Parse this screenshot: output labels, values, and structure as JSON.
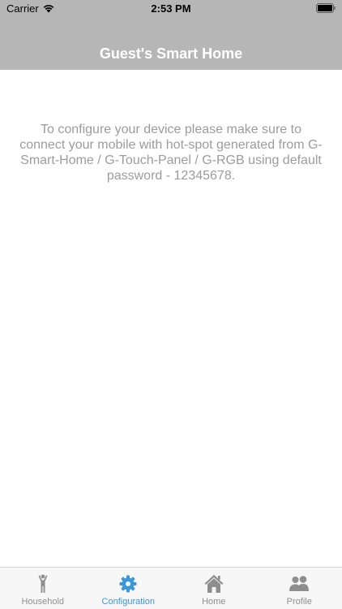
{
  "status_bar": {
    "carrier": "Carrier",
    "time": "2:53 PM"
  },
  "header": {
    "title": "Guest's Smart Home"
  },
  "main": {
    "message": "To configure your device please make sure to connect your mobile with hot-spot generated from G-Smart-Home / G-Touch-Panel / G-RGB using default password - 12345678."
  },
  "tabs": [
    {
      "label": "Household",
      "icon": "person-icon",
      "active": false
    },
    {
      "label": "Configuration",
      "icon": "gear-icon",
      "active": true
    },
    {
      "label": "Home",
      "icon": "house-icon",
      "active": false
    },
    {
      "label": "Profile",
      "icon": "people-icon",
      "active": false
    }
  ],
  "colors": {
    "header": "#b6b6b6",
    "accent": "#3a97d8",
    "inactive": "#8e8e8e"
  }
}
